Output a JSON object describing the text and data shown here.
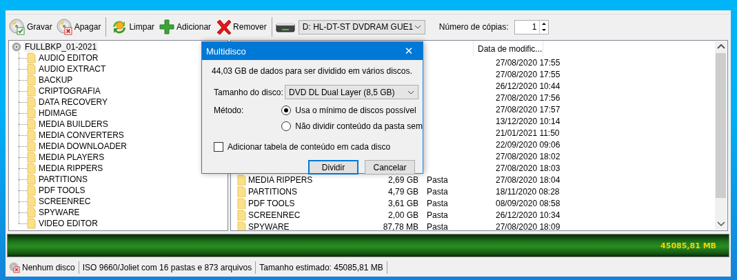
{
  "toolbar": {
    "groups": [
      [
        {
          "label": "Gravar",
          "kind": "burn"
        },
        {
          "label": "Apagar",
          "kind": "erase"
        }
      ],
      [
        {
          "label": "Limpar",
          "kind": "clean"
        },
        {
          "label": "Adicionar",
          "kind": "add"
        },
        {
          "label": "Remover",
          "kind": "remove"
        }
      ]
    ],
    "drive_select": {
      "value": "D: HL-DT-ST DVDRAM GUE1"
    },
    "copies": {
      "label": "Número de cópias:",
      "value": "1"
    }
  },
  "tree": {
    "root": {
      "label": "FULLBKP_01-2021",
      "selected": true,
      "children": [
        {
          "label": "AUDIO EDITOR",
          "selected": false
        },
        {
          "label": "AUDIO EXTRACT",
          "selected": false
        },
        {
          "label": "BACKUP",
          "selected": false
        },
        {
          "label": "CRIPTOGRAFIA",
          "selected": false
        },
        {
          "label": "DATA RECOVERY",
          "selected": false
        },
        {
          "label": "HDIMAGE",
          "selected": false
        },
        {
          "label": "MEDIA BUILDERS",
          "selected": false
        },
        {
          "label": "MEDIA CONVERTERS",
          "selected": false
        },
        {
          "label": "MEDIA DOWNLOADER",
          "selected": false
        },
        {
          "label": "MEDIA PLAYERS",
          "selected": false
        },
        {
          "label": "MEDIA RIPPERS",
          "selected": false
        },
        {
          "label": "PARTITIONS",
          "selected": false
        },
        {
          "label": "PDF TOOLS",
          "selected": false
        },
        {
          "label": "SCREENREC",
          "selected": false
        },
        {
          "label": "SPYWARE",
          "selected": false
        },
        {
          "label": "VIDEO EDITOR",
          "selected": false
        }
      ]
    }
  },
  "file_list": {
    "columns": [
      {
        "label": "Data de modific..."
      }
    ],
    "rows": [
      {
        "date": "27/08/2020 17:55"
      },
      {
        "date": "27/08/2020 17:55"
      },
      {
        "date": "26/12/2020 10:44"
      },
      {
        "date": "27/08/2020 17:56"
      },
      {
        "date": "27/08/2020 17:57"
      },
      {
        "date": "13/12/2020 10:14"
      },
      {
        "date": "21/01/2021 11:50"
      },
      {
        "date": "22/09/2020 09:06"
      },
      {
        "date": "27/08/2020 18:02"
      },
      {
        "date": "27/08/2020 18:03"
      },
      {
        "name": "MEDIA RIPPERS",
        "size": "2,69 GB",
        "type": "Pasta",
        "date": "27/08/2020 18:04"
      },
      {
        "name": "PARTITIONS",
        "size": "4,79 GB",
        "type": "Pasta",
        "date": "18/11/2020 08:28"
      },
      {
        "name": "PDF TOOLS",
        "size": "3,61 GB",
        "type": "Pasta",
        "date": "08/09/2020 08:58"
      },
      {
        "name": "SCREENREC",
        "size": "2,00 GB",
        "type": "Pasta",
        "date": "26/12/2020 10:34"
      },
      {
        "name": "SPYWARE",
        "size": "87,78 MB",
        "type": "Pasta",
        "date": "27/08/2020 18:09"
      }
    ]
  },
  "dialog": {
    "title": "Multidisco",
    "close": "✕",
    "message": "44,03 GB de dados para ser dividido em vários discos.",
    "disc_size": {
      "label": "Tamanho do disco:",
      "value": "DVD DL Dual Layer (8,5 GB)"
    },
    "method": {
      "label": "Método:",
      "options": [
        {
          "label": "Usa o mínimo de discos possível",
          "selected": true
        },
        {
          "label": "Não dividir conteúdo da pasta sem",
          "selected": false
        }
      ]
    },
    "checkbox": {
      "label": "Adicionar tabela de conteúdo em cada disco",
      "checked": false
    },
    "buttons": [
      {
        "label": "Dividir",
        "default": true
      },
      {
        "label": "Cancelar",
        "default": false
      }
    ]
  },
  "capacity": {
    "level": 1,
    "reading": "45085,81 MB"
  },
  "status_bar": [
    {
      "text": "Nenhum disco",
      "kind": "no-disc"
    },
    {
      "text": "ISO 9660/Joliet com 16 pastas e 873 arquivos"
    },
    {
      "text": "Tamanho estimado: 45085,81 MB"
    }
  ]
}
